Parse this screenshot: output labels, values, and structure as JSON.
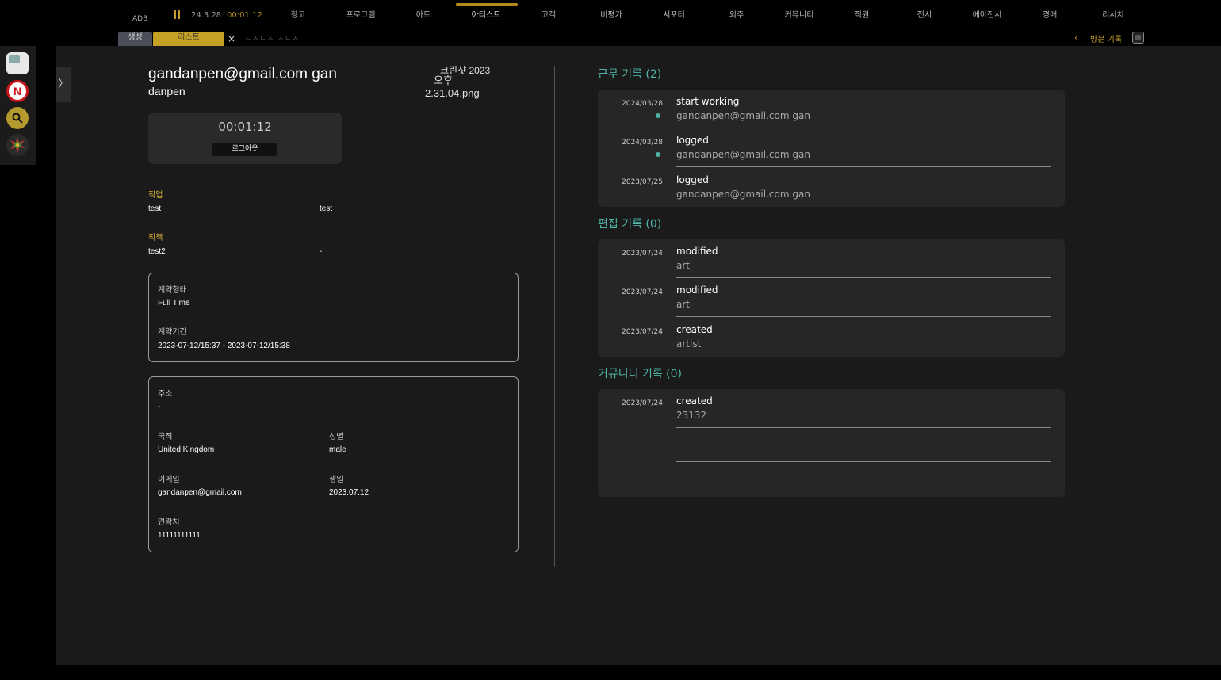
{
  "topbar": {
    "adb": "ADB",
    "date": "24.3.28",
    "timer": "00:01:12",
    "nav": [
      "창고",
      "프로그램",
      "아트",
      "아티스트",
      "고객",
      "비평가",
      "서포터",
      "외주",
      "커뮤니티",
      "직원",
      "전시",
      "에이전시",
      "경매",
      "리서치"
    ],
    "active_nav": "아티스트",
    "subtab_create": "생성",
    "subtab_list": "리스트",
    "close": "×",
    "ghost_tab": "ㄷㅅㄷㅅ ㅈㄷㅅ...",
    "visit_label": "방문 기록",
    "visit_chevron": "‹"
  },
  "rail": {
    "icons": [
      "image-icon",
      "naver-icon",
      "search-icon",
      "flower-icon"
    ],
    "naver_letter": "N"
  },
  "profile": {
    "name_line1": "gandanpen@gmail.com gan",
    "name_line2": "danpen",
    "broken_image_line1": "크린샷 2023",
    "broken_image_line2": "오후",
    "broken_image_line3": "2.31.04.png",
    "timer": "00:01:12",
    "logout_label": "로그아웃",
    "job_label": "직업",
    "job_value1": "test",
    "job_value2": "test",
    "position_label": "직책",
    "position_value1": "test2",
    "position_value2": "-"
  },
  "contract": {
    "type_label": "계약형태",
    "type_value": "Full Time",
    "period_label": "계약기간",
    "period_value": "2023-07-12/15:37 - 2023-07-12/15:38"
  },
  "personal": {
    "address_label": "주소",
    "address_value": "-",
    "nationality_label": "국적",
    "nationality_value": "United Kingdom",
    "gender_label": "성별",
    "gender_value": "male",
    "email_label": "이메일",
    "email_value": "gandanpen@gmail.com",
    "birthday_label": "생일",
    "birthday_value": "2023.07.12",
    "phone_label": "연락처",
    "phone_value": "11111111111"
  },
  "logs": {
    "work": {
      "title": "근무 기록 (2)",
      "rows": [
        {
          "date": "2024/03/28",
          "action": "start working",
          "detail": "gandanpen@gmail.com gan"
        },
        {
          "date": "2024/03/28",
          "action": "logged",
          "detail": "gandanpen@gmail.com gan"
        },
        {
          "date": "2023/07/25",
          "action": "logged",
          "detail": "gandanpen@gmail.com gan"
        }
      ]
    },
    "edit": {
      "title": "편집 기록 (0)",
      "rows": [
        {
          "date": "2023/07/24",
          "action": "modified",
          "detail": "art"
        },
        {
          "date": "2023/07/24",
          "action": "modified",
          "detail": "art"
        },
        {
          "date": "2023/07/24",
          "action": "created",
          "detail": "artist"
        }
      ]
    },
    "community": {
      "title": "커뮤니티 기록 (0)",
      "rows": [
        {
          "date": "2023/07/24",
          "action": "created",
          "detail": "23132"
        },
        {
          "date": "",
          "action": "",
          "detail": ""
        }
      ]
    }
  },
  "colors": {
    "accent_gold": "#c49a2c",
    "accent_teal": "#4fb3a6"
  }
}
